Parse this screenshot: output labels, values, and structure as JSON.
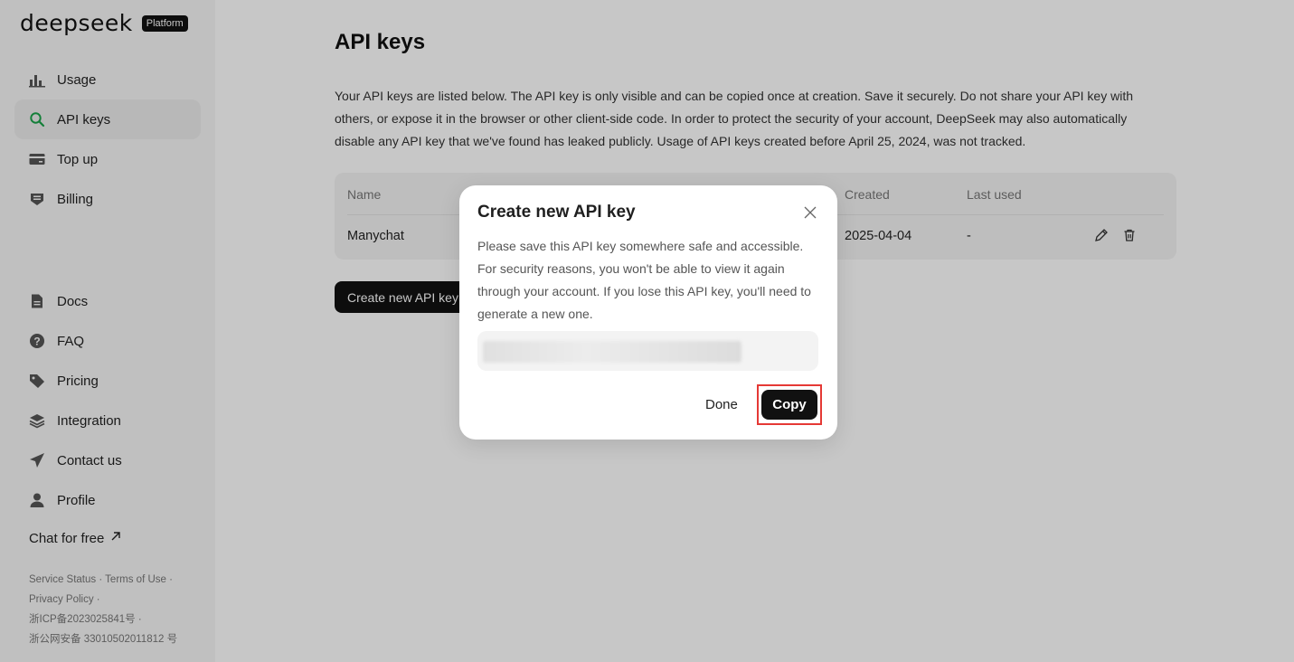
{
  "brand": {
    "logo": "deepseek",
    "badge": "Platform"
  },
  "sidebar": {
    "top_items": [
      {
        "label": "Usage",
        "icon": "bar-chart-icon"
      },
      {
        "label": "API keys",
        "icon": "search-icon",
        "active": true
      },
      {
        "label": "Top up",
        "icon": "credit-card-icon"
      },
      {
        "label": "Billing",
        "icon": "receipt-icon"
      }
    ],
    "bottom_items": [
      {
        "label": "Docs",
        "icon": "document-icon"
      },
      {
        "label": "FAQ",
        "icon": "question-icon"
      },
      {
        "label": "Pricing",
        "icon": "tag-icon"
      },
      {
        "label": "Integration",
        "icon": "layers-icon"
      },
      {
        "label": "Contact us",
        "icon": "send-icon"
      },
      {
        "label": "Profile",
        "icon": "user-icon"
      }
    ],
    "chat_for_free": "Chat for free",
    "footer": {
      "service_status": "Service Status",
      "terms": "Terms of Use",
      "privacy": "Privacy Policy",
      "icp": "浙ICP备2023025841号",
      "police": "浙公网安备 33010502011812 号"
    }
  },
  "main": {
    "title": "API keys",
    "description": "Your API keys are listed below. The API key is only visible and can be copied once at creation. Save it securely. Do not share your API key with others, or expose it in the browser or other client-side code. In order to protect the security of your account, DeepSeek may also automatically disable any API key that we've found has leaked publicly. Usage of API keys created before April 25, 2024, was not tracked.",
    "table": {
      "headers": {
        "name": "Name",
        "created": "Created",
        "last_used": "Last used"
      },
      "rows": [
        {
          "name": "Manychat",
          "created": "2025-04-04",
          "last_used": "-"
        }
      ]
    },
    "create_button": "Create new API key"
  },
  "modal": {
    "title": "Create new API key",
    "body": "Please save this API key somewhere safe and accessible. For security reasons, you won't be able to view it again through your account. If you lose this API key, you'll need to generate a new one.",
    "done_label": "Done",
    "copy_label": "Copy"
  },
  "colors": {
    "accent_active_icon": "#1aa34a",
    "highlight_border": "#e53935",
    "primary_button": "#111111"
  }
}
